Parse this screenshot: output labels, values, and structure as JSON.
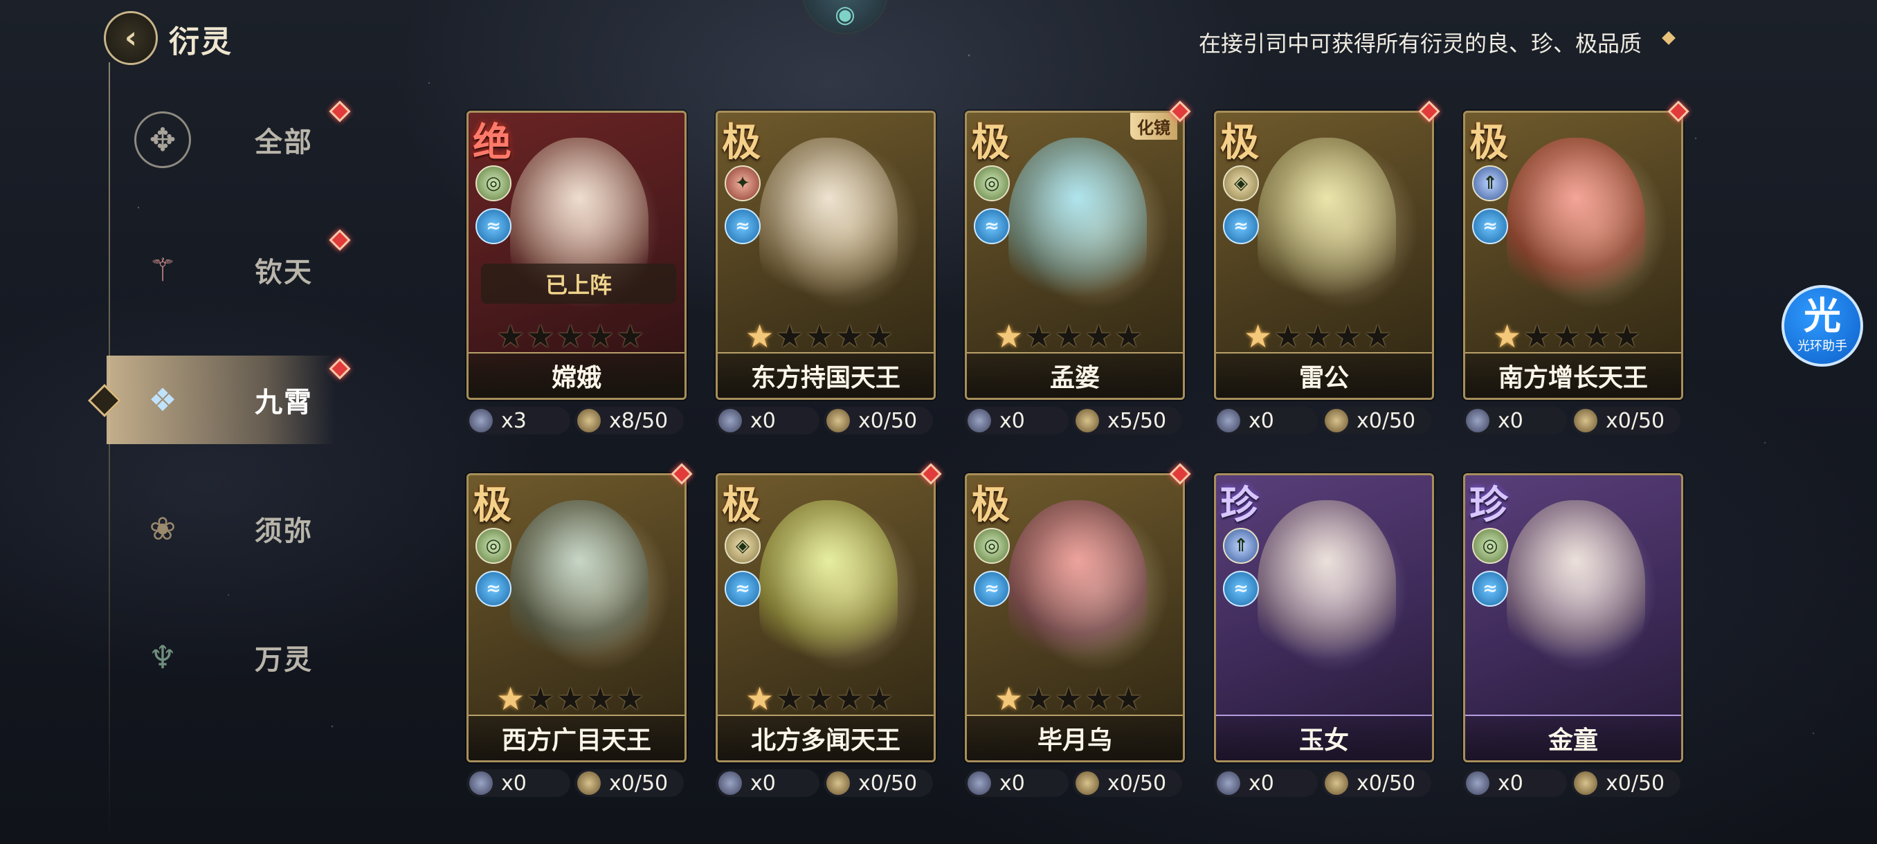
{
  "header": {
    "back_icon": "chevron-left-icon",
    "title": "衍灵",
    "notice": "在接引司中可获得所有衍灵的良、珍、极品质"
  },
  "sidebar": {
    "categories": [
      {
        "label": "全部",
        "icon": "all-emblem-icon",
        "active": false,
        "has_alert": true
      },
      {
        "label": "钦天",
        "icon": "qintian-emblem-icon",
        "active": false,
        "has_alert": true
      },
      {
        "label": "九霄",
        "icon": "jiuxiao-emblem-icon",
        "active": true,
        "has_alert": true
      },
      {
        "label": "须弥",
        "icon": "xumi-emblem-icon",
        "active": false,
        "has_alert": false
      },
      {
        "label": "万灵",
        "icon": "wanling-emblem-icon",
        "active": false,
        "has_alert": false
      }
    ]
  },
  "cards": [
    {
      "name": "嫦娥",
      "rank": "绝",
      "theme": "red",
      "stars": 0,
      "deployed_label": "已上阵",
      "tag": "",
      "count": "x3",
      "shards": "x8/50",
      "alert": false
    },
    {
      "name": "东方持国天王",
      "rank": "极",
      "theme": "gold",
      "stars": 1,
      "deployed_label": "",
      "tag": "",
      "count": "x0",
      "shards": "x0/50",
      "alert": false
    },
    {
      "name": "孟婆",
      "rank": "极",
      "theme": "gold",
      "stars": 1,
      "deployed_label": "",
      "tag": "化镜",
      "count": "x0",
      "shards": "x5/50",
      "alert": true
    },
    {
      "name": "雷公",
      "rank": "极",
      "theme": "gold",
      "stars": 1,
      "deployed_label": "",
      "tag": "",
      "count": "x0",
      "shards": "x0/50",
      "alert": true
    },
    {
      "name": "南方增长天王",
      "rank": "极",
      "theme": "gold",
      "stars": 1,
      "deployed_label": "",
      "tag": "",
      "count": "x0",
      "shards": "x0/50",
      "alert": true
    },
    {
      "name": "西方广目天王",
      "rank": "极",
      "theme": "gold",
      "stars": 1,
      "deployed_label": "",
      "tag": "",
      "count": "x0",
      "shards": "x0/50",
      "alert": true
    },
    {
      "name": "北方多闻天王",
      "rank": "极",
      "theme": "gold",
      "stars": 1,
      "deployed_label": "",
      "tag": "",
      "count": "x0",
      "shards": "x0/50",
      "alert": true
    },
    {
      "name": "毕月乌",
      "rank": "极",
      "theme": "gold",
      "stars": 1,
      "deployed_label": "",
      "tag": "",
      "count": "x0",
      "shards": "x0/50",
      "alert": true
    },
    {
      "name": "玉女",
      "rank": "珍",
      "theme": "purple",
      "stars": 0,
      "deployed_label": "",
      "tag": "",
      "count": "x0",
      "shards": "x0/50",
      "alert": false
    },
    {
      "name": "金童",
      "rank": "珍",
      "theme": "purple",
      "stars": 0,
      "deployed_label": "",
      "tag": "",
      "count": "x0",
      "shards": "x0/50",
      "alert": false
    }
  ],
  "assistant": {
    "big": "光",
    "small": "光环助手",
    "icon": "light-ring-assistant-icon"
  },
  "colors": {
    "alert_red": "#e23b3b",
    "gold_border": "#a78f5b",
    "active_sidebar": "#d6be96"
  }
}
